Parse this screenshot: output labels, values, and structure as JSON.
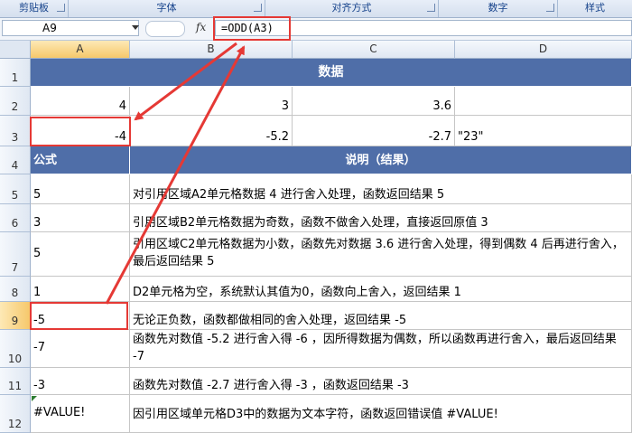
{
  "ribbon": {
    "groups": [
      "剪贴板",
      "字体",
      "对齐方式",
      "数字",
      "样式"
    ]
  },
  "formula_bar": {
    "name_box": "A9",
    "fx": "fx",
    "formula": "=ODD(A3)"
  },
  "columns": [
    "A",
    "B",
    "C",
    "D"
  ],
  "rows": [
    "1",
    "2",
    "3",
    "4",
    "5",
    "6",
    "7",
    "8",
    "9",
    "10",
    "11",
    "12"
  ],
  "data_table": {
    "title": "数据",
    "row2": [
      "4",
      "3",
      "3.6",
      ""
    ],
    "row3": [
      "-4",
      "-5.2",
      "-2.7",
      "\"23\""
    ]
  },
  "results": {
    "header_formula": "公式",
    "header_desc": "说明（结果）",
    "items": [
      {
        "value": "5",
        "desc": "对引用区域A2单元格数据 4 进行舍入处理，函数返回结果 5"
      },
      {
        "value": "3",
        "desc": "引用区域B2单元格数据为奇数，函数不做舍入处理，直接返回原值 3"
      },
      {
        "value": "5",
        "desc": "引用区域C2单元格数据为小数，函数先对数据 3.6 进行舍入处理，得到偶数 4 后再进行舍入，最后返回结果 5"
      },
      {
        "value": "1",
        "desc": "D2单元格为空，系统默认其值为0，函数向上舍入，返回结果 1"
      },
      {
        "value": "-5",
        "desc": "无论正负数，函数都做相同的舍入处理，返回结果 -5"
      },
      {
        "value": "-7",
        "desc": "函数先对数值 -5.2 进行舍入得 -6 ，因所得数据为偶数，所以函数再进行舍入，最后返回结果 -7"
      },
      {
        "value": "-3",
        "desc": "函数先对数值 -2.7 进行舍入得 -3 ，函数返回结果 -3"
      },
      {
        "value": "#VALUE!",
        "desc": "因引用区域单元格D3中的数据为文本字符，函数返回错误值 #VALUE!"
      }
    ]
  },
  "colors": {
    "header_bg": "#4f6ea8",
    "highlight": "#e53935"
  }
}
